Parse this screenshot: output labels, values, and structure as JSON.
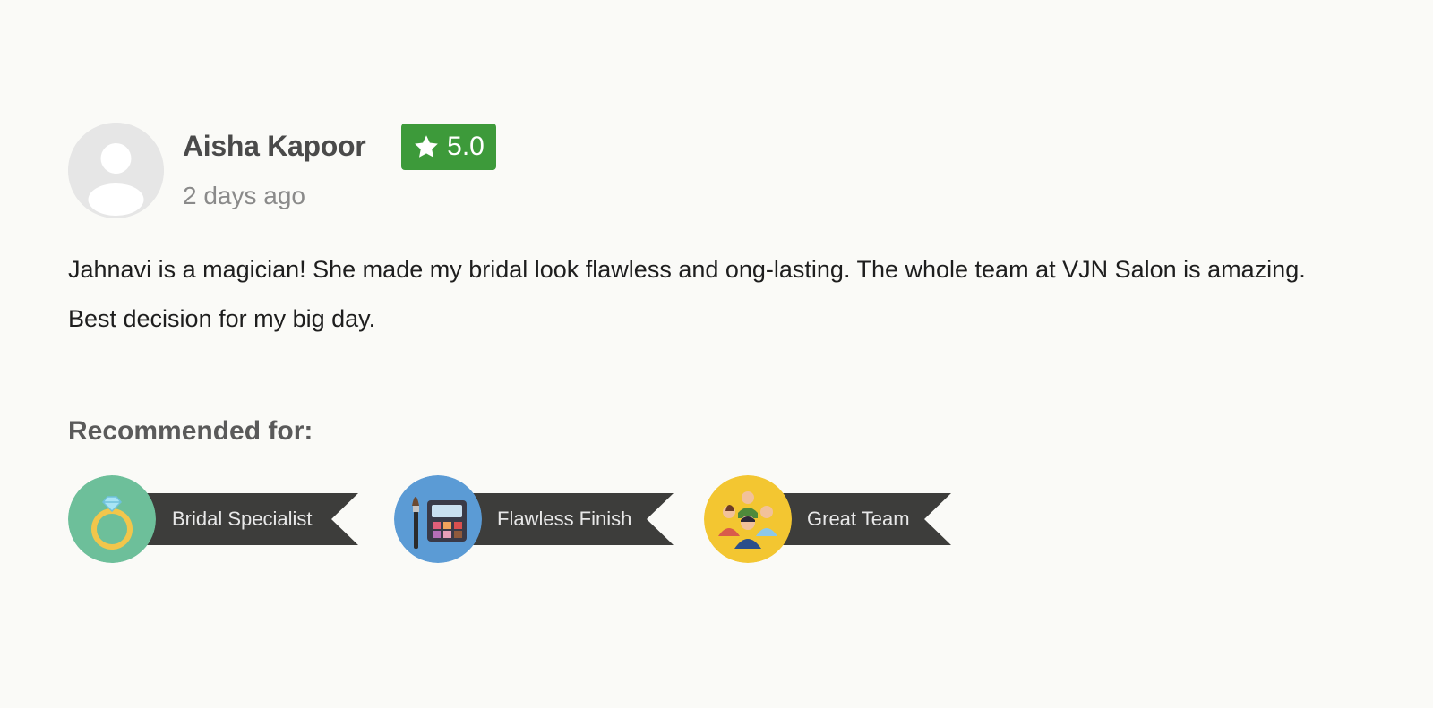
{
  "review": {
    "author": "Aisha Kapoor",
    "timestamp": "2 days ago",
    "rating": "5.0",
    "text": "Jahnavi is a magician! She made my bridal look flawless and ong-lasting. The whole team at VJN Salon is amazing. Best decision for my big day.",
    "avatar_icon": "user-placeholder-icon",
    "rating_icon": "star-icon",
    "colors": {
      "rating_badge": "#3d9a3a",
      "ribbon": "#3d3d3b"
    }
  },
  "recommended": {
    "heading": "Recommended for:",
    "tags": [
      {
        "label": "Bridal Specialist",
        "icon": "diamond-ring-icon",
        "color": "#6dbf9a"
      },
      {
        "label": "Flawless Finish",
        "icon": "makeup-palette-icon",
        "color": "#5b9bd5"
      },
      {
        "label": "Great Team",
        "icon": "team-people-icon",
        "color": "#f3c631"
      }
    ]
  }
}
